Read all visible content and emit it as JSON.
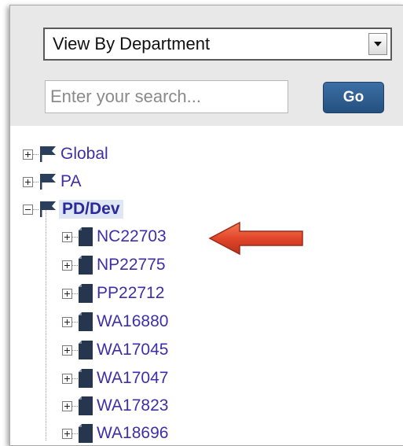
{
  "department_select": {
    "value": "View By Department"
  },
  "search": {
    "placeholder": "Enter your search...",
    "go_label": "Go"
  },
  "tree": {
    "roots": [
      {
        "label": "Global",
        "expanded": false
      },
      {
        "label": "PA",
        "expanded": false
      },
      {
        "label": "PD/Dev",
        "expanded": true,
        "selected": true
      }
    ],
    "children": [
      {
        "label": "NC22703"
      },
      {
        "label": "NP22775"
      },
      {
        "label": "PP22712"
      },
      {
        "label": "WA16880"
      },
      {
        "label": "WA17045"
      },
      {
        "label": "WA17047"
      },
      {
        "label": "WA17823"
      },
      {
        "label": "WA18696"
      }
    ]
  },
  "colors": {
    "link": "#3e2fa8",
    "go_button": "#2c5d8f",
    "arrow": "#e2462a",
    "toolbar_bg": "#e8e8e8"
  },
  "icons": {
    "root": "flag-icon",
    "child": "document-icon",
    "collapsed": "plus-icon",
    "expanded": "minus-icon"
  }
}
